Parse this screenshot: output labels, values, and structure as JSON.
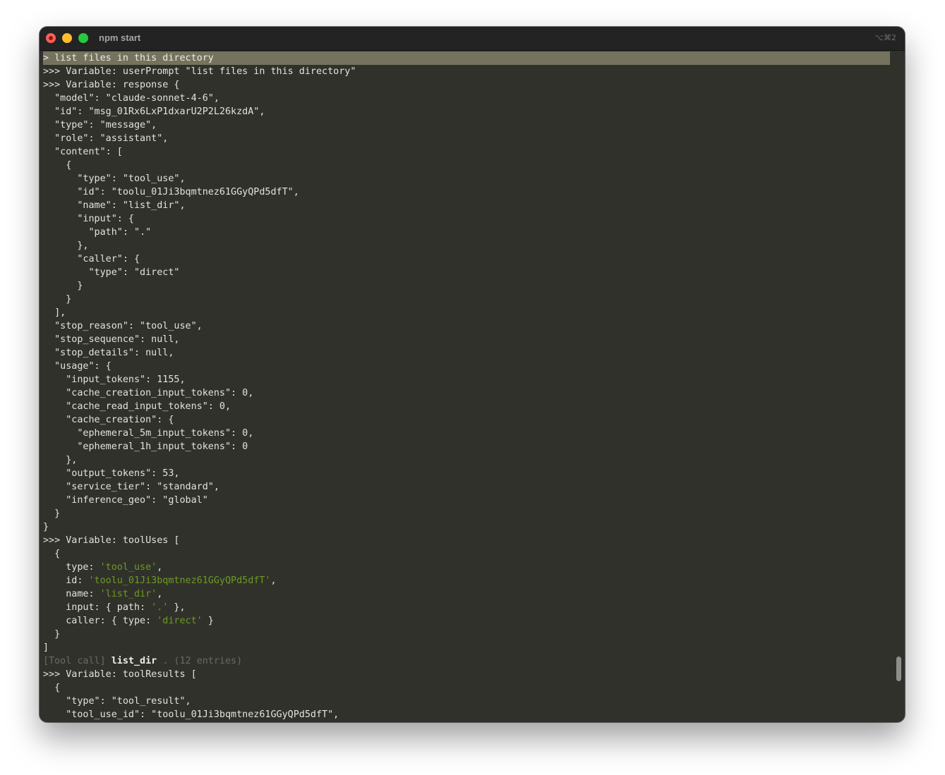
{
  "window": {
    "title": "npm start",
    "shortcut": "⌥⌘2"
  },
  "terminal": {
    "input_line": "> list files in this directory",
    "lines": [
      ">>> Variable: userPrompt \"list files in this directory\"",
      ">>> Variable: response {",
      "  \"model\": \"claude-sonnet-4-6\",",
      "  \"id\": \"msg_01Rx6LxP1dxarU2P2L26kzdA\",",
      "  \"type\": \"message\",",
      "  \"role\": \"assistant\",",
      "  \"content\": [",
      "    {",
      "      \"type\": \"tool_use\",",
      "      \"id\": \"toolu_01Ji3bqmtnez61GGyQPd5dfT\",",
      "      \"name\": \"list_dir\",",
      "      \"input\": {",
      "        \"path\": \".\"",
      "      },",
      "      \"caller\": {",
      "        \"type\": \"direct\"",
      "      }",
      "    }",
      "  ],",
      "  \"stop_reason\": \"tool_use\",",
      "  \"stop_sequence\": null,",
      "  \"stop_details\": null,",
      "  \"usage\": {",
      "    \"input_tokens\": 1155,",
      "    \"cache_creation_input_tokens\": 0,",
      "    \"cache_read_input_tokens\": 0,",
      "    \"cache_creation\": {",
      "      \"ephemeral_5m_input_tokens\": 0,",
      "      \"ephemeral_1h_input_tokens\": 0",
      "    },",
      "    \"output_tokens\": 53,",
      "    \"service_tier\": \"standard\",",
      "    \"inference_geo\": \"global\"",
      "  }",
      "}",
      ">>> Variable: toolUses ["
    ],
    "tool_uses": {
      "open_brace": "  {",
      "type_key": "    type: ",
      "type_val": "'tool_use'",
      "id_key": "    id: ",
      "id_val": "'toolu_01Ji3bqmtnez61GGyQPd5dfT'",
      "name_key": "    name: ",
      "name_val": "'list_dir'",
      "input_key": "    input: { path: ",
      "input_val": "'.'",
      "input_close": " },",
      "caller_key": "    caller: { type: ",
      "caller_val": "'direct'",
      "caller_close": " }",
      "close_brace": "  }",
      "close_bracket": "]",
      "comma": ","
    },
    "tool_call": {
      "prefix": "[Tool call]",
      "name": "list_dir",
      "suffix": ". (12 entries)"
    },
    "tail_lines": [
      ">>> Variable: toolResults [",
      "  {",
      "    \"type\": \"tool_result\",",
      "    \"tool_use_id\": \"toolu_01Ji3bqmtnez61GGyQPd5dfT\","
    ]
  },
  "colors": {
    "background": "#31312c",
    "titlebar": "#232323",
    "highlight": "#75735e",
    "text": "#e3e3dc",
    "string": "#6b9b22",
    "dim": "#6a6a60"
  }
}
